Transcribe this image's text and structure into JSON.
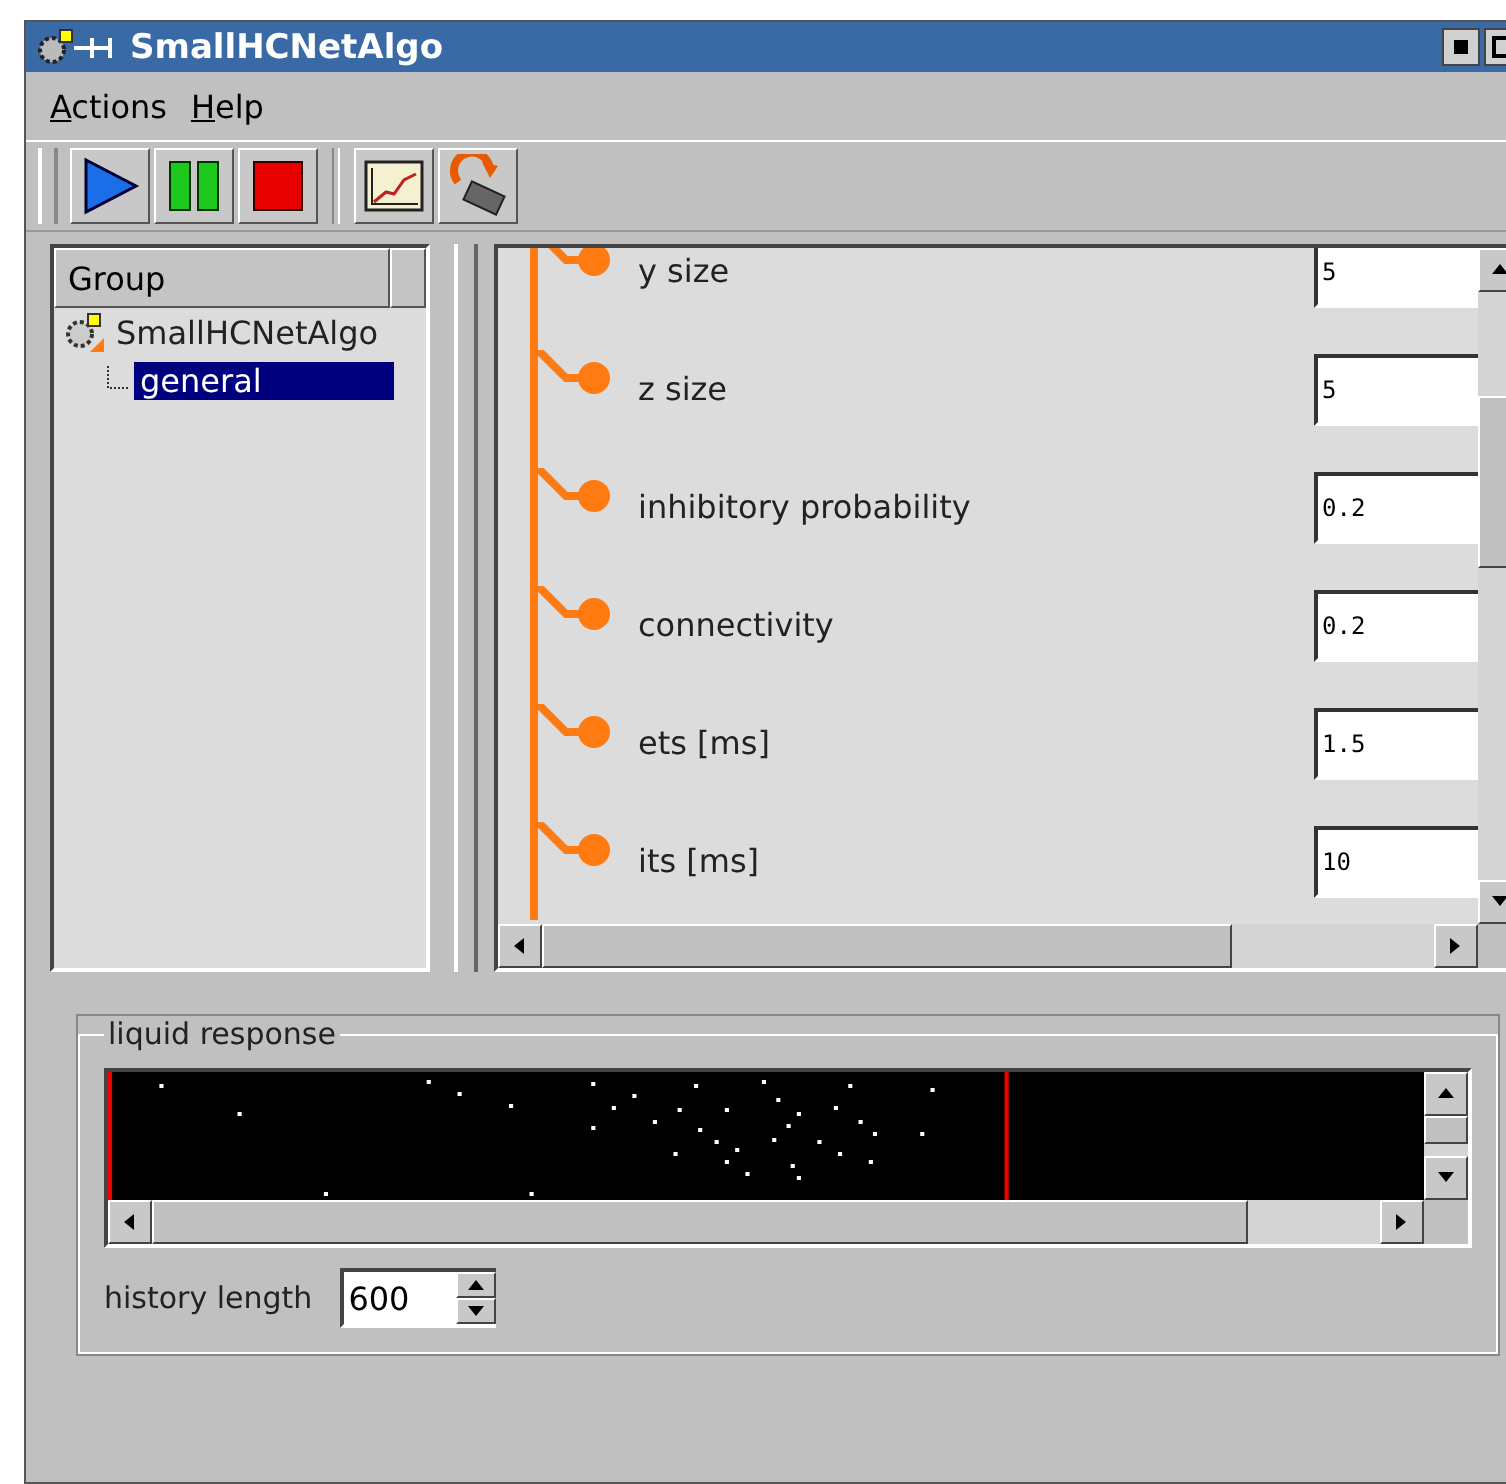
{
  "window": {
    "title": "SmallHCNetAlgo"
  },
  "menu": [
    {
      "label": "Actions"
    },
    {
      "label": "Help"
    }
  ],
  "toolbar": [
    {
      "kind": "play"
    },
    {
      "kind": "pause"
    },
    {
      "kind": "stop"
    },
    {
      "kind": "sep"
    },
    {
      "kind": "chart"
    },
    {
      "kind": "reload"
    }
  ],
  "tree": {
    "header": "Group",
    "items": [
      {
        "label": "SmallHCNetAlgo",
        "selected": false,
        "children": [
          {
            "label": "general",
            "selected": true
          }
        ]
      }
    ]
  },
  "params": [
    {
      "label": "y size",
      "value": "5"
    },
    {
      "label": "z size",
      "value": "5"
    },
    {
      "label": "inhibitory probability",
      "value": "0.2"
    },
    {
      "label": "connectivity",
      "value": "0.2"
    },
    {
      "label": "ets [ms]",
      "value": "1.5"
    },
    {
      "label": "its [ms]",
      "value": "10"
    }
  ],
  "liquid": {
    "title": "liquid response",
    "history_label": "history length",
    "history_value": "600"
  }
}
